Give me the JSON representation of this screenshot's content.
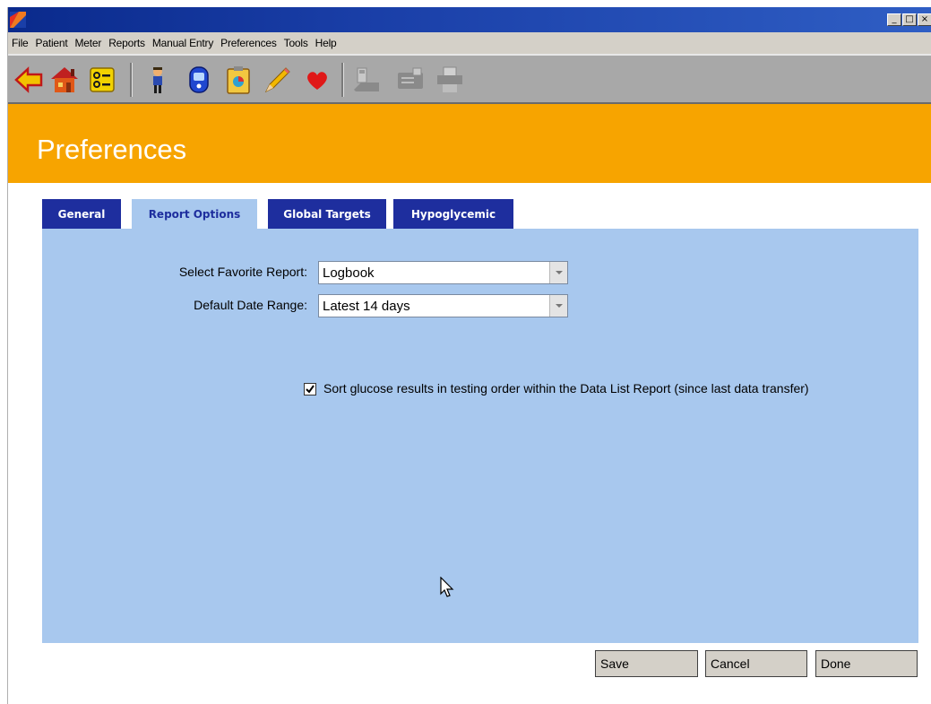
{
  "window": {
    "minimize": "_",
    "maximize": "□",
    "close": "×"
  },
  "menu": [
    "File",
    "Patient",
    "Meter",
    "Reports",
    "Manual Entry",
    "Preferences",
    "Tools",
    "Help"
  ],
  "toolbar": {
    "icons": [
      "back-arrow-icon",
      "home-icon",
      "patient-list-icon",
      "patient-icon",
      "meter-icon",
      "report-icon",
      "pencil-icon",
      "heart-icon",
      "device-icon",
      "card-reader-icon",
      "printer-icon"
    ]
  },
  "banner": {
    "title": "Preferences",
    "color": "#f7a400"
  },
  "tabs": [
    {
      "label": "General",
      "active": false
    },
    {
      "label": "Report Options",
      "active": true
    },
    {
      "label": "Global Targets",
      "active": false
    },
    {
      "label": "Hypoglycemic",
      "active": false
    }
  ],
  "form": {
    "favorite_report_label": "Select Favorite Report:",
    "favorite_report_value": "Logbook",
    "date_range_label": "Default Date Range:",
    "date_range_value": "Latest 14 days",
    "sort_checked": true,
    "sort_label": "Sort glucose results in testing order within the Data List Report (since last data transfer)"
  },
  "buttons": {
    "save": "Save",
    "cancel": "Cancel",
    "done": "Done"
  },
  "colors": {
    "tab_inactive": "#1e2e9e",
    "panel": "#a8c8ee",
    "banner": "#f7a400"
  }
}
